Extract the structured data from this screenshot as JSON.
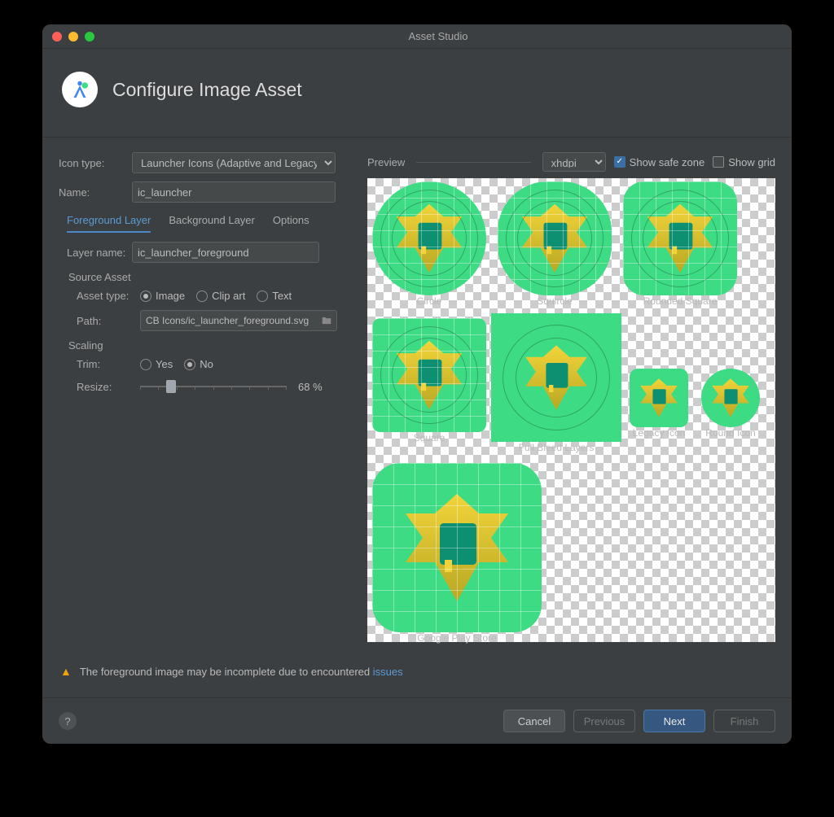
{
  "window": {
    "title": "Asset Studio"
  },
  "header": {
    "title": "Configure Image Asset"
  },
  "form": {
    "iconTypeLabel": "Icon type:",
    "iconTypeValue": "Launcher Icons (Adaptive and Legacy)",
    "nameLabel": "Name:",
    "nameValue": "ic_launcher"
  },
  "tabs": {
    "foreground": "Foreground Layer",
    "background": "Background Layer",
    "options": "Options"
  },
  "layer": {
    "nameLabel": "Layer name:",
    "nameValue": "ic_launcher_foreground"
  },
  "sourceAsset": {
    "heading": "Source Asset",
    "assetTypeLabel": "Asset type:",
    "options": {
      "image": "Image",
      "clipart": "Clip art",
      "text": "Text"
    },
    "pathLabel": "Path:",
    "pathValue": "CB Icons/ic_launcher_foreground.svg"
  },
  "scaling": {
    "heading": "Scaling",
    "trimLabel": "Trim:",
    "yes": "Yes",
    "no": "No",
    "resizeLabel": "Resize:",
    "resizeValue": "68 %"
  },
  "preview": {
    "label": "Preview",
    "density": "xhdpi",
    "safeZone": "Show safe zone",
    "showGrid": "Show grid",
    "shapes": {
      "circle": "Circle",
      "squircle": "Squircle",
      "rounded": "Rounded Square",
      "square": "Square",
      "full": "Full Bleed Layers",
      "legacy": "Legacy Icon",
      "round": "Round Icon",
      "play": "Google Play Store"
    }
  },
  "warning": {
    "text": "The foreground image may be incomplete due to encountered ",
    "link": "issues"
  },
  "footer": {
    "cancel": "Cancel",
    "previous": "Previous",
    "next": "Next",
    "finish": "Finish"
  }
}
